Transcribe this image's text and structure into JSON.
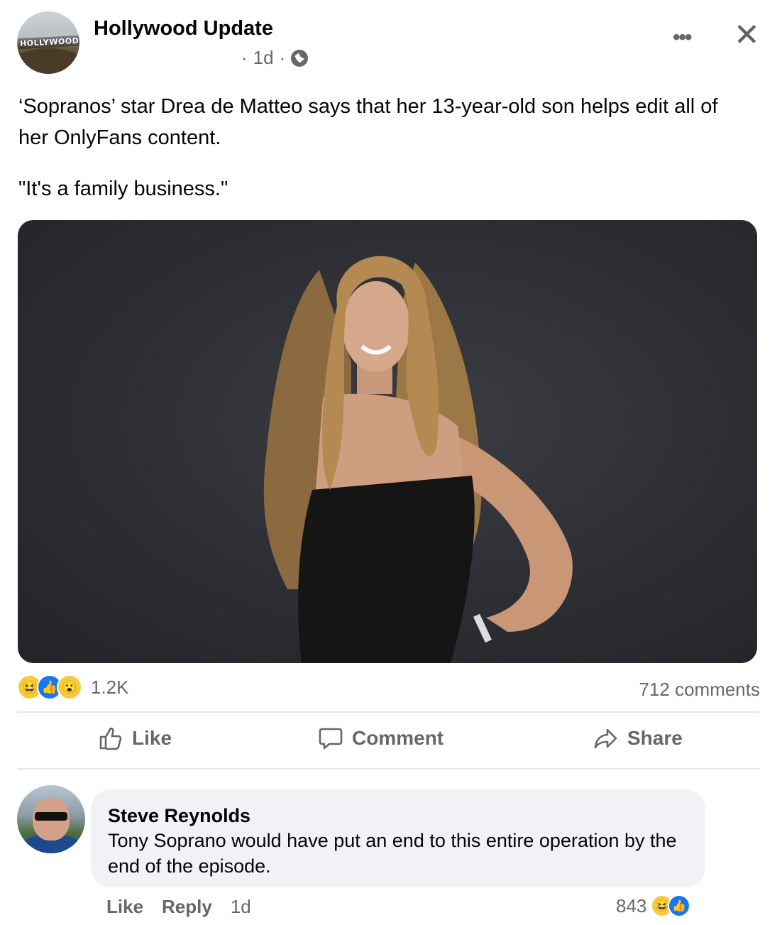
{
  "post": {
    "page_name": "Hollywood Update",
    "avatar_sign": "HOLLYWOOD",
    "time": "1d",
    "separator": "·",
    "text": "‘Sopranos’ star Drea de Matteo says that her 13-year-old son helps edit all of her OnlyFans content.",
    "quote": "\"It's a family business.\"",
    "more_icon": "•••",
    "close_icon": "✕"
  },
  "stats": {
    "reaction_count": "1.2K",
    "comments_count": "712 comments",
    "reaction_icons": [
      "haha-icon",
      "like-icon",
      "wow-icon"
    ]
  },
  "actions": {
    "like": "Like",
    "comment": "Comment",
    "share": "Share"
  },
  "comment": {
    "author": "Steve Reynolds",
    "text": "Tony Soprano would have put an end to this entire operation by the end of the episode.",
    "like": "Like",
    "reply": "Reply",
    "time": "1d",
    "reaction_count": "843"
  },
  "colors": {
    "accent": "#1877f2",
    "muted_text": "#65676b",
    "bubble": "#f0f2f5",
    "photo_bg": "#2c2e33"
  }
}
